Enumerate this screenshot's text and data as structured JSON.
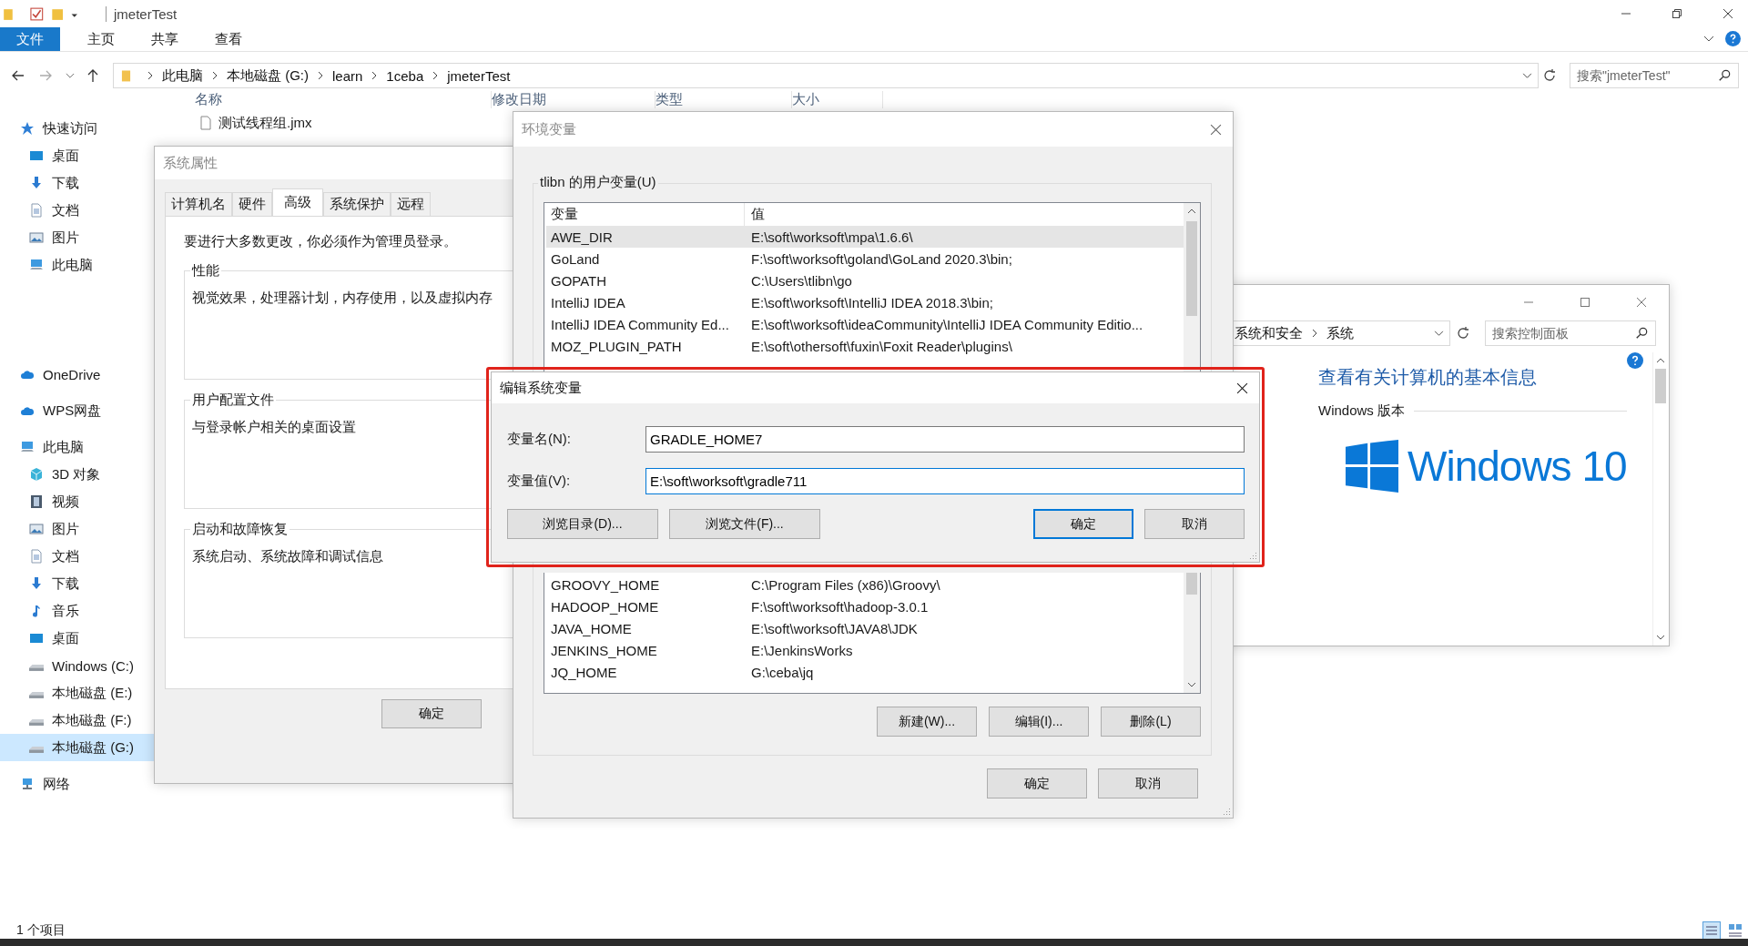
{
  "explorer": {
    "title": "jmeterTest",
    "ribbon_tabs": [
      {
        "label": "文件",
        "selected": true
      },
      {
        "label": "主页",
        "selected": false
      },
      {
        "label": "共享",
        "selected": false
      },
      {
        "label": "查看",
        "selected": false
      }
    ],
    "breadcrumb": [
      "此电脑",
      "本地磁盘 (G:)",
      "learn",
      "1ceba",
      "jmeterTest"
    ],
    "search": {
      "placeholder": "搜索\"jmeterTest\""
    },
    "columns": [
      "名称",
      "修改日期",
      "类型",
      "大小"
    ],
    "files": [
      {
        "name": "测试线程组.jmx"
      }
    ],
    "sidebar": [
      {
        "label": "快速访问",
        "kind": "star",
        "selected": false,
        "children": [
          {
            "label": "桌面",
            "kind": "desktop",
            "selected": false
          },
          {
            "label": "下载",
            "kind": "download",
            "selected": false
          },
          {
            "label": "文档",
            "kind": "document",
            "selected": false
          },
          {
            "label": "图片",
            "kind": "picture",
            "selected": false
          },
          {
            "label": "此电脑",
            "kind": "computer",
            "selected": false
          }
        ]
      },
      {
        "label": "OneDrive",
        "kind": "cloud",
        "selected": false
      },
      {
        "label": "WPS网盘",
        "kind": "cloud",
        "selected": false
      },
      {
        "label": "此电脑",
        "kind": "computer",
        "selected": false,
        "children": [
          {
            "label": "3D 对象",
            "kind": "cube",
            "selected": false
          },
          {
            "label": "视频",
            "kind": "video",
            "selected": false
          },
          {
            "label": "图片",
            "kind": "picture",
            "selected": false
          },
          {
            "label": "文档",
            "kind": "document",
            "selected": false
          },
          {
            "label": "下载",
            "kind": "download",
            "selected": false
          },
          {
            "label": "音乐",
            "kind": "music",
            "selected": false
          },
          {
            "label": "桌面",
            "kind": "desktop",
            "selected": false
          },
          {
            "label": "Windows (C:)",
            "kind": "drive",
            "selected": false
          },
          {
            "label": "本地磁盘 (E:)",
            "kind": "drive",
            "selected": false
          },
          {
            "label": "本地磁盘 (F:)",
            "kind": "drive",
            "selected": false
          },
          {
            "label": "本地磁盘 (G:)",
            "kind": "drive",
            "selected": true
          }
        ]
      },
      {
        "label": "网络",
        "kind": "network",
        "selected": false
      }
    ],
    "status_bar": "1 个项目"
  },
  "system_properties": {
    "title": "系统属性",
    "tabs": [
      {
        "label": "计算机名",
        "selected": false
      },
      {
        "label": "硬件",
        "selected": false
      },
      {
        "label": "高级",
        "selected": true
      },
      {
        "label": "系统保护",
        "selected": false
      },
      {
        "label": "远程",
        "selected": false
      }
    ],
    "notice": "要进行大多数更改，你必须作为管理员登录。",
    "groups": [
      {
        "label": "性能",
        "text": "视觉效果，处理器计划，内存使用，以及虚拟内存"
      },
      {
        "label": "用户配置文件",
        "text": "与登录帐户相关的桌面设置"
      },
      {
        "label": "启动和故障恢复",
        "text": "系统启动、系统故障和调试信息"
      }
    ],
    "buttons": [
      "确定"
    ]
  },
  "environment_variables": {
    "title": "环境变量",
    "user_group": "tlibn 的用户变量(U)",
    "columns": [
      "变量",
      "值"
    ],
    "user_variables": [
      {
        "name": "AWE_DIR",
        "value": "E:\\soft\\worksoft\\mpa\\1.6.6\\",
        "selected": true
      },
      {
        "name": "GoLand",
        "value": "F:\\soft\\worksoft\\goland\\GoLand 2020.3\\bin;",
        "selected": false
      },
      {
        "name": "GOPATH",
        "value": "C:\\Users\\tlibn\\go",
        "selected": false
      },
      {
        "name": "IntelliJ IDEA",
        "value": "E:\\soft\\worksoft\\IntelliJ IDEA 2018.3\\bin;",
        "selected": false
      },
      {
        "name": "IntelliJ IDEA Community Ed...",
        "value": "E:\\soft\\worksoft\\ideaCommunity\\IntelliJ IDEA Community Editio...",
        "selected": false
      },
      {
        "name": "MOZ_PLUGIN_PATH",
        "value": "E:\\soft\\othersoft\\fuxin\\Foxit Reader\\plugins\\",
        "selected": false
      }
    ],
    "system_variables": [
      {
        "name": "GROOVY_HOME",
        "value": "C:\\Program Files (x86)\\Groovy\\"
      },
      {
        "name": "HADOOP_HOME",
        "value": "F:\\soft\\worksoft\\hadoop-3.0.1"
      },
      {
        "name": "JAVA_HOME",
        "value": "E:\\soft\\worksoft\\JAVA8\\JDK"
      },
      {
        "name": "JENKINS_HOME",
        "value": "E:\\JenkinsWorks"
      },
      {
        "name": "JQ_HOME",
        "value": "G:\\ceba\\jq"
      }
    ],
    "list_buttons": [
      "新建(W)...",
      "编辑(I)...",
      "删除(L)"
    ],
    "buttons": [
      "确定",
      "取消"
    ]
  },
  "control_panel": {
    "breadcrumb": [
      "系统和安全",
      "系统"
    ],
    "search": {
      "placeholder": "搜索控制面板"
    },
    "heading": "查看有关计算机的基本信息",
    "section": "Windows 版本",
    "logo_text": "Windows 10"
  },
  "edit_dialog": {
    "title": "编辑系统变量",
    "fields": [
      {
        "label": "变量名(N):",
        "value": "GRADLE_HOME7",
        "focused": false
      },
      {
        "label": "变量值(V):",
        "value": "E:\\soft\\worksoft\\gradle711",
        "focused": true
      }
    ],
    "browse_buttons": [
      "浏览目录(D)...",
      "浏览文件(F)..."
    ],
    "buttons": [
      {
        "label": "确定",
        "default": true
      },
      {
        "label": "取消",
        "default": false
      }
    ]
  }
}
